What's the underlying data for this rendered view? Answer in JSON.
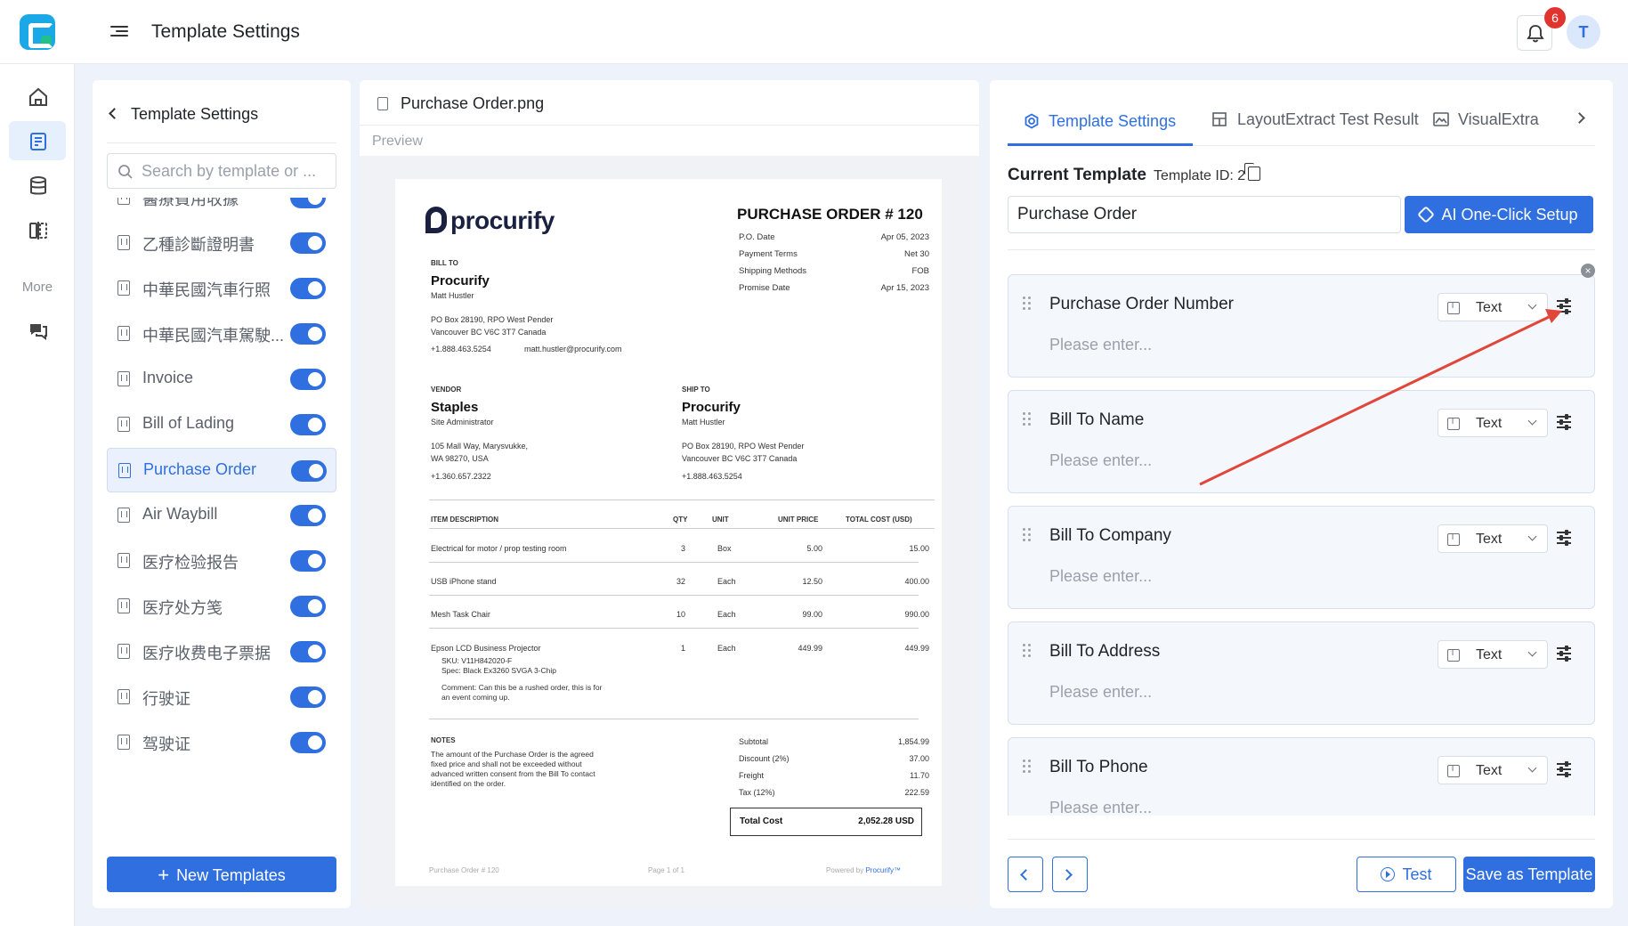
{
  "header": {
    "title": "Template Settings",
    "notification_count": "6",
    "avatar_initial": "T"
  },
  "rail": {
    "more_label": "More"
  },
  "list_panel": {
    "back_label": "Template Settings",
    "search_placeholder": "Search by template or ...",
    "items": [
      {
        "label": "醫療費用收據",
        "enabled": true
      },
      {
        "label": "乙種診斷證明書",
        "enabled": true
      },
      {
        "label": "中華民國汽車行照",
        "enabled": true
      },
      {
        "label": "中華民國汽車駕駛...",
        "enabled": true
      },
      {
        "label": "Invoice",
        "enabled": true
      },
      {
        "label": "Bill of Lading",
        "enabled": true
      },
      {
        "label": "Purchase Order",
        "enabled": true,
        "active": true
      },
      {
        "label": "Air Waybill",
        "enabled": true
      },
      {
        "label": "医疗检验报告",
        "enabled": true
      },
      {
        "label": "医疗处方笺",
        "enabled": true
      },
      {
        "label": "医疗收费电子票据",
        "enabled": true
      },
      {
        "label": "行驶证",
        "enabled": true
      },
      {
        "label": "驾驶证",
        "enabled": true
      }
    ],
    "new_button": "New Templates"
  },
  "preview": {
    "file_name": "Purchase Order.png",
    "label": "Preview",
    "doc": {
      "brand": "procurify",
      "po_title": "PURCHASE ORDER # 120",
      "meta": [
        {
          "k": "P.O. Date",
          "v": "Apr 05, 2023"
        },
        {
          "k": "Payment Terms",
          "v": "Net 30"
        },
        {
          "k": "Shipping Methods",
          "v": "FOB"
        },
        {
          "k": "Promise Date",
          "v": "Apr 15, 2023"
        }
      ],
      "bill_to_label": "BILL TO",
      "bill_to_company": "Procurify",
      "bill_to_name": "Matt Hustler",
      "bill_to_addr1": "PO Box 28190, RPO West Pender",
      "bill_to_addr2": "Vancouver BC V6C 3T7 Canada",
      "bill_to_phone": "+1.888.463.5254",
      "bill_to_email": "matt.hustler@procurify.com",
      "vendor_label": "VENDOR",
      "vendor_company": "Staples",
      "vendor_name": "Site Administrator",
      "vendor_addr1": "105 Mall Way, Marysvukke,",
      "vendor_addr2": "WA 98270, USA",
      "vendor_phone": "+1.360.657.2322",
      "ship_to_label": "SHIP TO",
      "ship_to_company": "Procurify",
      "ship_to_name": "Matt Hustler",
      "ship_to_addr1": "PO Box 28190, RPO West Pender",
      "ship_to_addr2": "Vancouver BC V6C 3T7 Canada",
      "ship_to_phone": "+1.888.463.5254",
      "cols": [
        "ITEM DESCRIPTION",
        "QTY",
        "UNIT",
        "UNIT PRICE",
        "TOTAL COST (USD)"
      ],
      "rows": [
        {
          "desc": "Electrical for motor / prop testing room",
          "qty": "3",
          "unit": "Box",
          "price": "5.00",
          "total": "15.00"
        },
        {
          "desc": "USB iPhone stand",
          "qty": "32",
          "unit": "Each",
          "price": "12.50",
          "total": "400.00"
        },
        {
          "desc": "Mesh Task Chair",
          "qty": "10",
          "unit": "Each",
          "price": "99.00",
          "total": "990.00"
        },
        {
          "desc": "Epson LCD Business Projector",
          "qty": "1",
          "unit": "Each",
          "price": "449.99",
          "total": "449.99"
        }
      ],
      "row4_sku": "SKU: V11H842020-F",
      "row4_spec": "Spec: Black Ex3260 SVGA 3-Chip",
      "row4_comment1": "Comment: Can this be a rushed order, this is for",
      "row4_comment2": "an event coming up.",
      "notes_label": "NOTES",
      "notes_lines": [
        "The amount of the Purchase Order is the agreed",
        "fixed price and shall not be exceeded without",
        "advanced written consent from the Bill To contact",
        "identified on the order."
      ],
      "totals": [
        {
          "k": "Subtotal",
          "v": "1,854.99"
        },
        {
          "k": "Discount (2%)",
          "v": "37.00"
        },
        {
          "k": "Freight",
          "v": "11.70"
        },
        {
          "k": "Tax (12%)",
          "v": "222.59"
        }
      ],
      "total_label": "Total Cost",
      "total_value": "2,052.28 USD",
      "footer_left": "Purchase Order # 120",
      "footer_mid": "Page 1 of 1",
      "footer_right_prefix": "Powered by ",
      "footer_right_brand": "Procurify™"
    }
  },
  "settings": {
    "tabs": [
      "Template Settings",
      "LayoutExtract Test Result",
      "VisualExtra"
    ],
    "current_template_label": "Current Template",
    "template_id": "Template ID: 2",
    "template_name": "Purchase Order",
    "ai_button": "AI One-Click Setup",
    "fields": [
      {
        "name": "Purchase Order Number",
        "type": "Text",
        "placeholder": "Please enter..."
      },
      {
        "name": "Bill To Name",
        "type": "Text",
        "placeholder": "Please enter..."
      },
      {
        "name": "Bill To Company",
        "type": "Text",
        "placeholder": "Please enter..."
      },
      {
        "name": "Bill To Address",
        "type": "Text",
        "placeholder": "Please enter..."
      },
      {
        "name": "Bill To Phone",
        "type": "Text",
        "placeholder": "Please enter..."
      }
    ],
    "test_button": "Test",
    "save_button": "Save as Template"
  },
  "colors": {
    "accent": "#2f6fe0",
    "badge": "#e2342f",
    "annotation_arrow": "#e0463a"
  }
}
